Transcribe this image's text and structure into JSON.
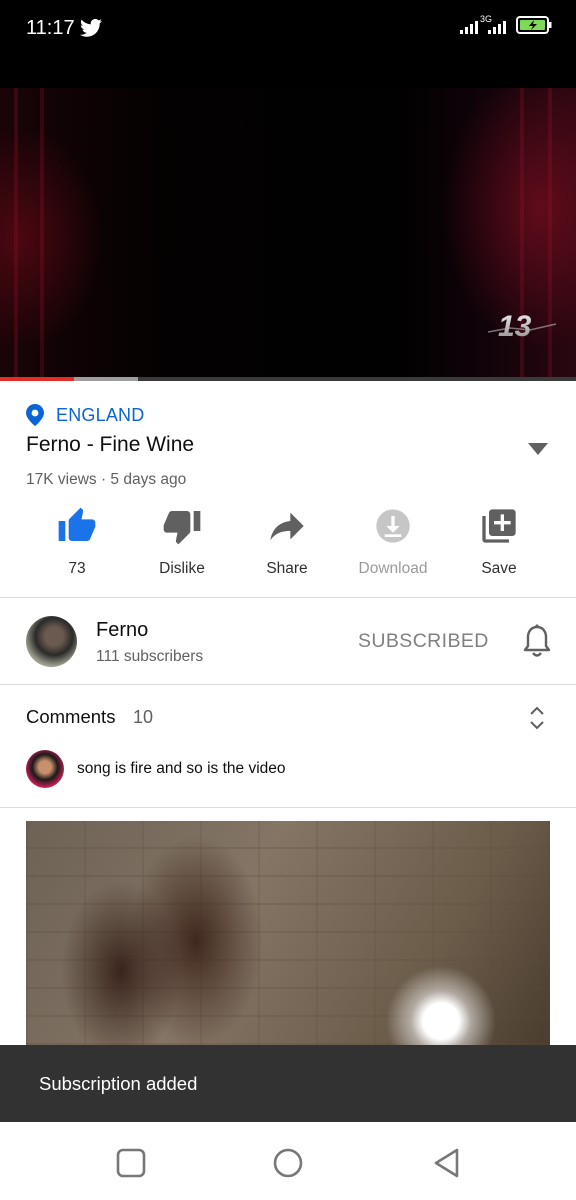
{
  "status_bar": {
    "time": "11:17",
    "network": "3G"
  },
  "video": {
    "watermark": "13",
    "progress_played_fraction": 0.128,
    "progress_buffered_fraction": 0.24
  },
  "info": {
    "location": "ENGLAND",
    "title": "Ferno - Fine Wine",
    "meta": "17K views · 5 days ago"
  },
  "actions": {
    "like_count": "73",
    "dislike_label": "Dislike",
    "share_label": "Share",
    "download_label": "Download",
    "save_label": "Save"
  },
  "channel": {
    "name": "Ferno",
    "subscribers": "111 subscribers",
    "subscribe_state": "SUBSCRIBED"
  },
  "comments": {
    "label": "Comments",
    "count": "10",
    "top_comment": "song is fire and so is the video"
  },
  "snackbar": {
    "message": "Subscription added"
  },
  "colors": {
    "accent_blue": "#0b64d4",
    "like_blue": "#1a73e8",
    "progress_red": "#e52d27",
    "snackbar_bg": "#323232"
  }
}
